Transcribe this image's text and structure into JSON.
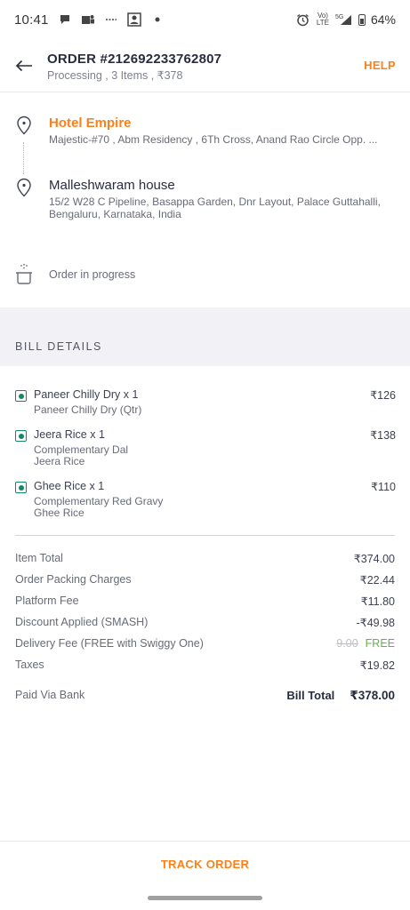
{
  "status_bar": {
    "time": "10:41",
    "lte_label": "Vo) LTE",
    "network_label": "5G",
    "battery": "64%"
  },
  "header": {
    "title": "ORDER #212692233762807",
    "subtitle": "Processing , 3 Items , ₹378",
    "help": "HELP"
  },
  "pickup": {
    "name": "Hotel Empire",
    "address": "Majestic-#70 , Abm Residency , 6Th Cross, Anand Rao Circle Opp. ..."
  },
  "drop": {
    "name": "Malleshwaram house",
    "address_line1": "15/2 W28 C Pipeline, Basappa Garden, Dnr Layout, Palace Guttahalli,",
    "address_line2": "Bengaluru, Karnataka, India"
  },
  "status_text": "Order in progress",
  "bill_details_title": "BILL DETAILS",
  "items": [
    {
      "name": "Paneer Chilly Dry x 1",
      "sub1": "Paneer Chilly Dry (Qtr)",
      "sub2": "",
      "price": "₹126"
    },
    {
      "name": "Jeera Rice x 1",
      "sub1": "Complementary Dal",
      "sub2": "Jeera Rice",
      "price": "₹138"
    },
    {
      "name": "Ghee Rice x 1",
      "sub1": "Complementary Red Gravy",
      "sub2": "Ghee Rice",
      "price": "₹110"
    }
  ],
  "charges": {
    "item_total": {
      "label": "Item Total",
      "value": "₹374.00"
    },
    "packing": {
      "label": "Order Packing Charges",
      "value": "₹22.44"
    },
    "platform": {
      "label": "Platform Fee",
      "value": "₹11.80"
    },
    "discount": {
      "label": "Discount Applied (SMASH)",
      "value": "-₹49.98"
    },
    "delivery": {
      "label": "Delivery Fee (FREE with Swiggy One)",
      "original": "9.00",
      "value": "FREE"
    },
    "taxes": {
      "label": "Taxes",
      "value": "₹19.82"
    }
  },
  "payment": {
    "method": "Paid Via Bank",
    "total_label": "Bill Total",
    "total_value": "₹378.00"
  },
  "footer": {
    "track_label": "TRACK ORDER"
  },
  "colors": {
    "accent": "#fc8019",
    "veg": "#0f8a65",
    "free": "#60b246"
  }
}
